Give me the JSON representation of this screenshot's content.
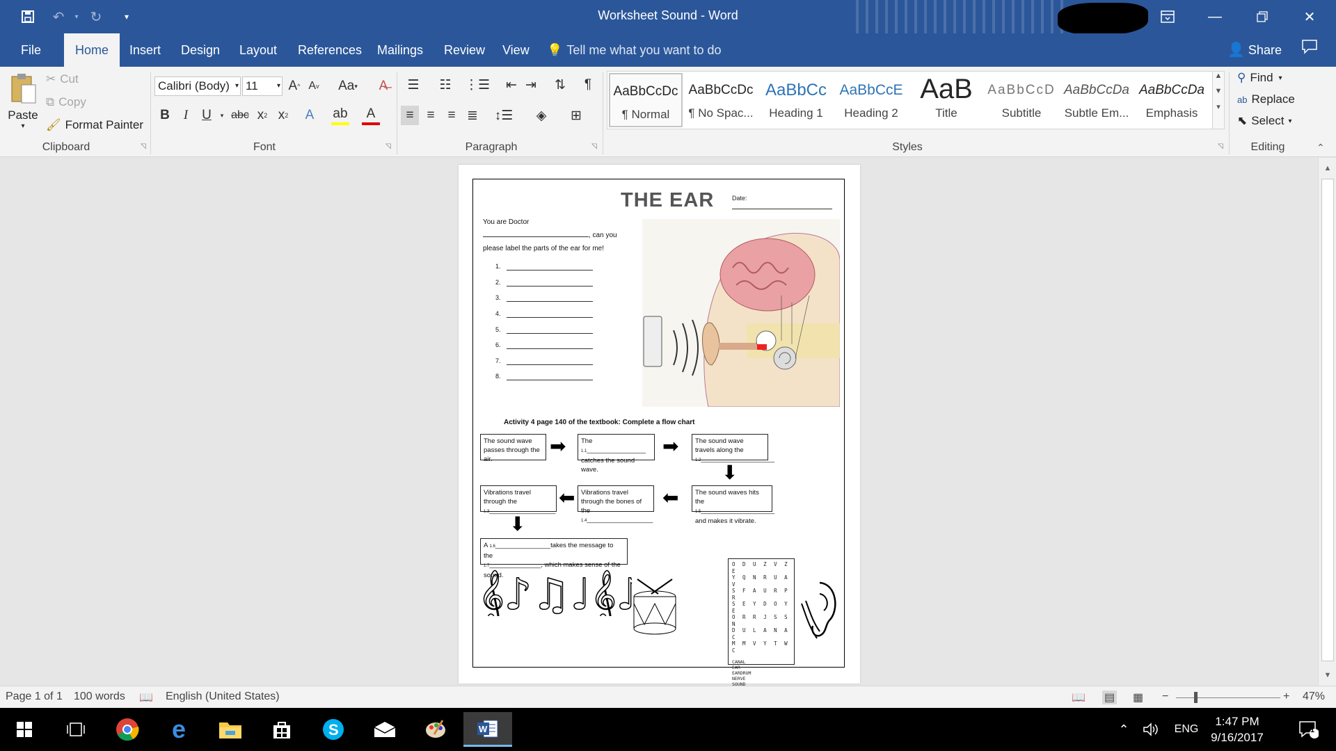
{
  "window": {
    "title": "Worksheet Sound  -  Word"
  },
  "tabs": [
    "File",
    "Home",
    "Insert",
    "Design",
    "Layout",
    "References",
    "Mailings",
    "Review",
    "View"
  ],
  "tell_me": "Tell me what you want to do",
  "share": "Share",
  "clipboard": {
    "paste": "Paste",
    "cut": "Cut",
    "copy": "Copy",
    "format_painter": "Format Painter",
    "label": "Clipboard"
  },
  "font": {
    "name": "Calibri (Body)",
    "size": "11",
    "label": "Font"
  },
  "paragraph": {
    "label": "Paragraph"
  },
  "styles": {
    "label": "Styles",
    "items": [
      {
        "sample": "AaBbCcDc",
        "name": "¶ Normal"
      },
      {
        "sample": "AaBbCcDc",
        "name": "¶ No Spac..."
      },
      {
        "sample": "AaBbCc",
        "name": "Heading 1"
      },
      {
        "sample": "AaBbCcE",
        "name": "Heading 2"
      },
      {
        "sample": "AaB",
        "name": "Title"
      },
      {
        "sample": "AaBbCcD",
        "name": "Subtitle"
      },
      {
        "sample": "AaBbCcDa",
        "name": "Subtle Em..."
      },
      {
        "sample": "AaBbCcDa",
        "name": "Emphasis"
      }
    ]
  },
  "editing": {
    "find": "Find",
    "replace": "Replace",
    "select": "Select",
    "label": "Editing"
  },
  "worksheet": {
    "title": "THE EAR",
    "date_label": "Date:",
    "intro_1": "You are Doctor",
    "intro_2": ", can you",
    "intro_3": "please label the parts of the ear for me!",
    "numbers": [
      "1.",
      "2.",
      "3.",
      "4.",
      "5.",
      "6.",
      "7.",
      "8."
    ],
    "activity": "Activity 4 page 140 of the textbook: Complete a flow chart",
    "box1": "The sound wave passes through the air.",
    "box2a": "The",
    "box2b": "catches the sound wave.",
    "box3a": "The sound wave travels along the",
    "box4a": "The sound waves hits the",
    "box4b": "and makes it vibrate.",
    "box5a": "Vibrations travel through the bones of the",
    "box6a": "Vibrations travel through the",
    "box7a": "A",
    "box7b": "takes the message to the",
    "box7c": ", which makes sense of the",
    "box7d": "sound.",
    "blank_1_1": "1.1",
    "blank_1_2": "1.2",
    "blank_1_3": "1.3",
    "blank_1_4": "1.4",
    "blank_1_5": "1.5",
    "blank_1_6": "1.6",
    "blank_1_7": "1.7",
    "wordsearch_rows": [
      "O D U Z V Z E",
      "Y Q N R U A V",
      "S F A U R P R",
      "S E Y D O Y E",
      "O R R J S S N",
      "D U L A N A C",
      "M M V Y T W C"
    ],
    "wordsearch_words": [
      "CANAL",
      "EAR",
      "EARDRUM",
      "NERVE",
      "SOUND"
    ]
  },
  "status": {
    "page": "Page 1 of 1",
    "words": "100 words",
    "language": "English (United States)",
    "zoom": "47%"
  },
  "taskbar": {
    "lang": "ENG",
    "time": "1:47 PM",
    "date": "9/16/2017",
    "notifications": "1"
  }
}
